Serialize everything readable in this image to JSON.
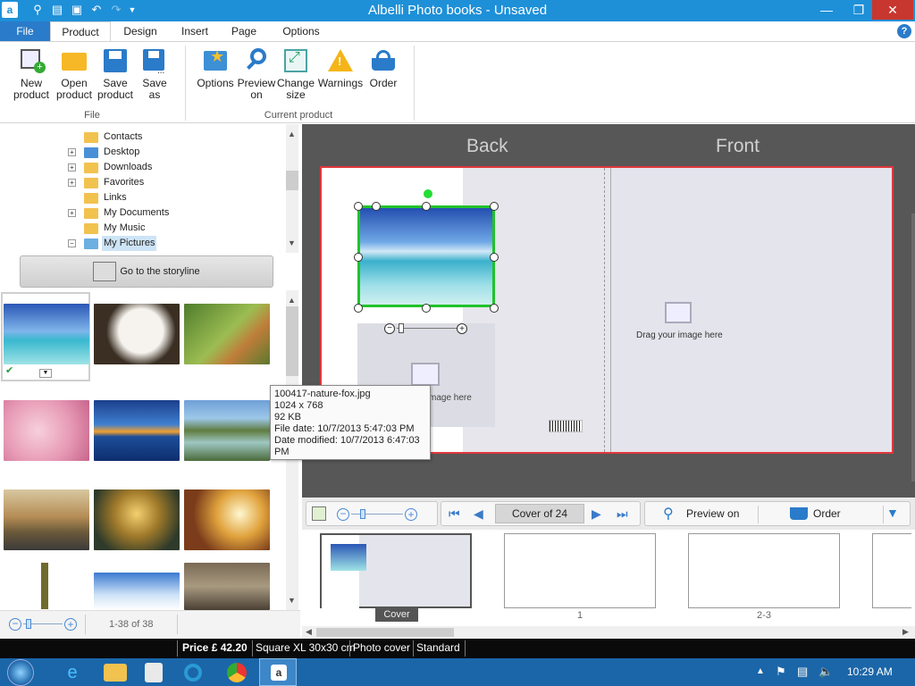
{
  "window": {
    "title": "Albelli Photo books - Unsaved"
  },
  "tabs": [
    {
      "label": "File"
    },
    {
      "label": "Product"
    },
    {
      "label": "Design"
    },
    {
      "label": "Insert"
    },
    {
      "label": "Page"
    },
    {
      "label": "Options"
    }
  ],
  "ribbon": {
    "file_group": {
      "label": "File",
      "buttons": [
        {
          "line1": "New",
          "line2": "product",
          "icon": "new-product-icon"
        },
        {
          "line1": "Open",
          "line2": "product",
          "icon": "open-folder-icon"
        },
        {
          "line1": "Save",
          "line2": "product",
          "icon": "save-icon"
        },
        {
          "line1": "Save",
          "line2": "as",
          "icon": "save-as-icon"
        }
      ]
    },
    "current_group": {
      "label": "Current product",
      "buttons": [
        {
          "line1": "Options",
          "line2": "",
          "icon": "options-icon"
        },
        {
          "line1": "Preview",
          "line2": "on",
          "icon": "magnifier-icon"
        },
        {
          "line1": "Change",
          "line2": "size",
          "icon": "resize-icon"
        },
        {
          "line1": "Warnings",
          "line2": "",
          "icon": "warning-icon"
        },
        {
          "line1": "Order",
          "line2": "",
          "icon": "basket-icon"
        }
      ]
    }
  },
  "tree": {
    "items": [
      {
        "label": "Contacts",
        "expandable": false
      },
      {
        "label": "Desktop",
        "expandable": true
      },
      {
        "label": "Downloads",
        "expandable": true
      },
      {
        "label": "Favorites",
        "expandable": true
      },
      {
        "label": "Links",
        "expandable": false
      },
      {
        "label": "My Documents",
        "expandable": true
      },
      {
        "label": "My Music",
        "expandable": false
      },
      {
        "label": "My Pictures",
        "expandable": true,
        "selected": true
      }
    ]
  },
  "storyline_button": "Go to the storyline",
  "left_footer": {
    "count": "1-38 of 38"
  },
  "canvas": {
    "back_label": "Back",
    "front_label": "Front",
    "drag_text_front": "Drag your image here",
    "drag_text_back_partial": "mage here"
  },
  "tooltip": {
    "filename": "100417-nature-fox.jpg",
    "dimensions": "1024 x 768",
    "size": "92   KB",
    "file_date": "File date: 10/7/2013 5:47:03 PM",
    "date_modified": "Date modified: 10/7/2013 6:47:03",
    "date_modified_cont": "PM"
  },
  "nav": {
    "page_label": "Cover of 24",
    "preview": "Preview on",
    "order": "Order"
  },
  "pages": [
    {
      "label": "Cover"
    },
    {
      "label": "1"
    },
    {
      "label": "2-3"
    }
  ],
  "status": {
    "price": "Price £ 42.20",
    "size": "Square XL 30x30 cm",
    "cover": "Photo cover",
    "type": "Standard"
  },
  "taskbar": {
    "time": "10:29 AM"
  }
}
